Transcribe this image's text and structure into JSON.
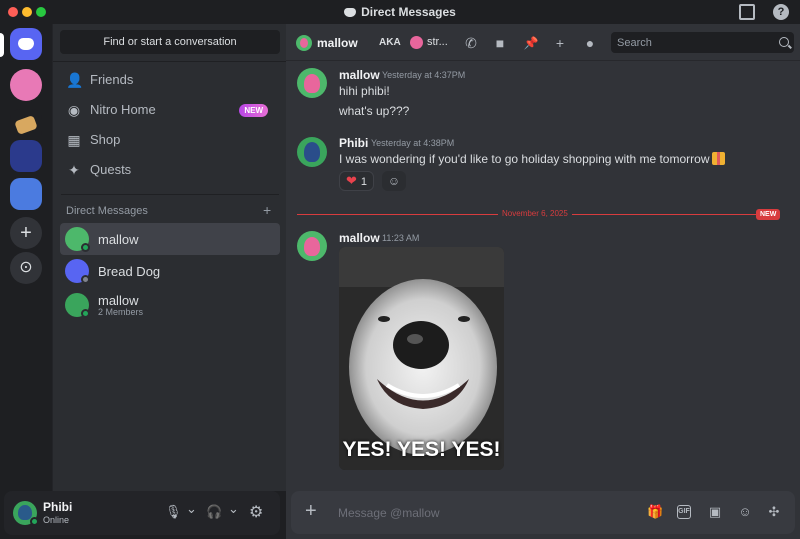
{
  "window": {
    "title": "Direct Messages"
  },
  "titlebar": {
    "help_glyph": "?"
  },
  "rail": {
    "add_glyph": "+",
    "explore_glyph": "⊙"
  },
  "sidebar": {
    "search_placeholder": "Find or start a conversation",
    "nav": [
      {
        "label": "Friends",
        "icon": "friends-icon",
        "glyph": "👤"
      },
      {
        "label": "Nitro Home",
        "icon": "nitro-icon",
        "glyph": "◉",
        "badge": "NEW"
      },
      {
        "label": "Shop",
        "icon": "shop-icon",
        "glyph": "▦"
      },
      {
        "label": "Quests",
        "icon": "quests-icon",
        "glyph": "✦"
      }
    ],
    "dm_header": "Direct Messages",
    "dm_add": "+",
    "dms": [
      {
        "name": "mallow",
        "sub": "",
        "avatar_color": "#4db86b",
        "status_color": "#23a55a"
      },
      {
        "name": "Bread Dog",
        "sub": "",
        "avatar_color": "#5865f2",
        "status_color": "#80848e"
      },
      {
        "name": "mallow",
        "sub": "2 Members",
        "avatar_color": "#3aa55c",
        "status_color": "#23a55a"
      }
    ]
  },
  "user_panel": {
    "name": "Phibi",
    "status": "Online",
    "mic_glyph": "🎙",
    "headset_glyph": "🎧",
    "settings_glyph": "⚙",
    "chevron_glyph": "⌄"
  },
  "header": {
    "name": "mallow",
    "aka_label": "AKA",
    "aka_name": "str...",
    "search_placeholder": "Search",
    "icons": {
      "call": "✆",
      "video": "■",
      "pin": "📌",
      "add_friends": "+",
      "profile": "●"
    }
  },
  "messages": [
    {
      "author": "mallow",
      "time": "Yesterday at 4:37PM",
      "lines": [
        "hihi phibi!",
        "what's up???"
      ]
    },
    {
      "author": "Phibi",
      "time": "Yesterday at 4:38PM",
      "lines": [
        "I was wondering if you'd like to go holiday shopping with me tomorrow"
      ],
      "reaction": {
        "emoji": "❤",
        "count": "1"
      },
      "add_reaction_glyph": "☺"
    }
  ],
  "divider": {
    "date": "November 6, 2025",
    "new_label": "NEW"
  },
  "last_message": {
    "author": "mallow",
    "time": "11:23 AM",
    "gif_caption": "YES! YES! YES!"
  },
  "composer": {
    "plus_glyph": "+",
    "placeholder": "Message @mallow",
    "buttons": {
      "gift": "🎁",
      "gif": "GIF",
      "sticker": "▣",
      "emoji": "☺",
      "apps": "✣"
    }
  },
  "colors": {
    "brand": "#5865f2",
    "online": "#23a55a",
    "new_divider": "#d83c3e",
    "background": "#313338",
    "sidebar": "#2b2d31"
  }
}
